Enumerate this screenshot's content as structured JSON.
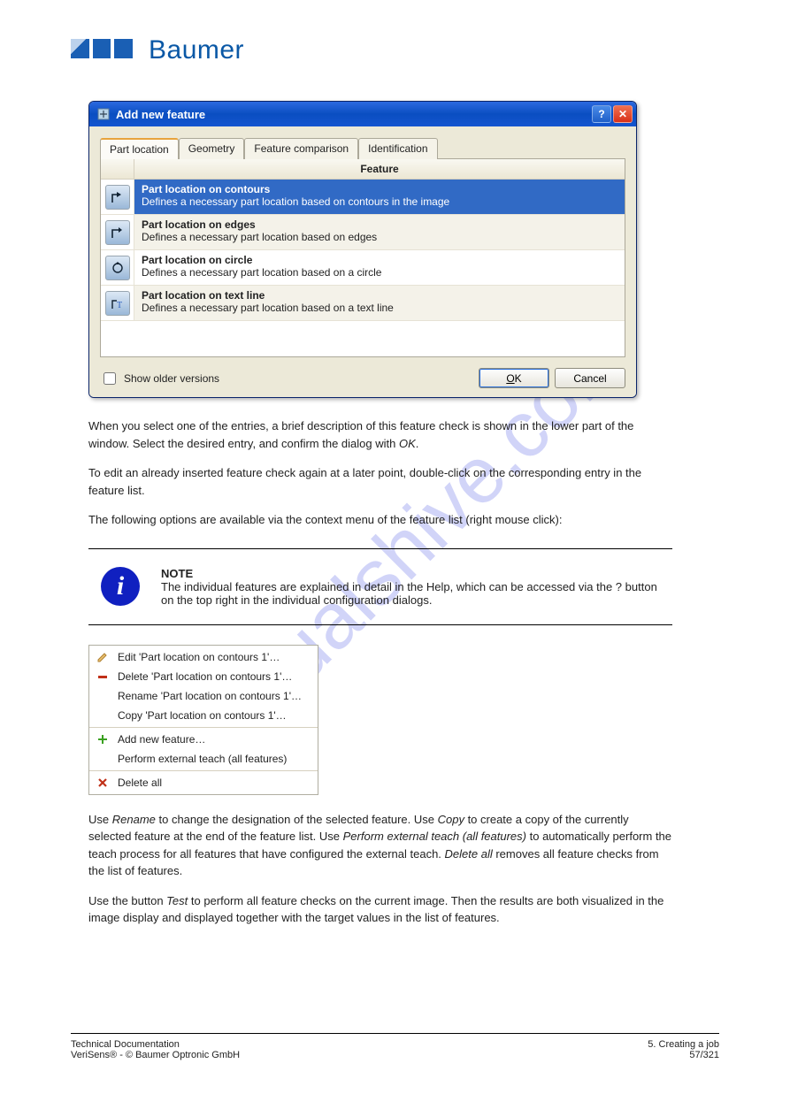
{
  "brand_name": "Baumer",
  "watermark": "manualshive.com",
  "dialog": {
    "title": "Add new feature",
    "tabs": [
      "Part location",
      "Geometry",
      "Feature comparison",
      "Identification"
    ],
    "feature_column_header": "Feature",
    "features": [
      {
        "title": "Part location on contours",
        "desc": "Defines a necessary part location based on contours in the image"
      },
      {
        "title": "Part location on edges",
        "desc": "Defines a necessary part location based on edges"
      },
      {
        "title": "Part location on circle",
        "desc": "Defines a necessary part location based on a circle"
      },
      {
        "title": "Part location on text line",
        "desc": "Defines a necessary part location based on a text line"
      }
    ],
    "show_older_label": "Show older versions",
    "ok_label": "OK",
    "cancel_label": "Cancel"
  },
  "body": {
    "p1_a": "When you select one of the entries, a brief description of this feature check is shown in the lower part of the window. Select the desired entry, and confirm the dialog with ",
    "p1_em": "OK",
    "p1_b": ".",
    "p2": "To edit an already inserted feature check again at a later point, double-click on the corresponding entry in the feature list.",
    "p3": "The following options are available via the context menu of the feature list (right mouse click):"
  },
  "note": {
    "strong": "NOTE",
    "rest": "The individual features are explained in detail in the Help, which can be accessed via the ? button on the top right in the individual configuration dialogs."
  },
  "context_menu": {
    "items": [
      "Edit 'Part location on contours 1'…",
      "Delete 'Part location on contours 1'…",
      "Rename 'Part location on contours 1'…",
      "Copy 'Part location on contours 1'…",
      "Add new feature…",
      "Perform external teach (all features)",
      "Delete all"
    ]
  },
  "after_menu": {
    "p1_a": "Use ",
    "p1_em1": "Rename",
    "p1_b": " to change the designation of the selected feature. Use ",
    "p1_em2": "Copy",
    "p1_c": " to create a copy of the currently selected feature at the end of the feature list. Use ",
    "p1_em3": "Perform external teach (all features)",
    "p1_d": " to automatically perform the teach process for all features that have configured the external teach. ",
    "p1_em4": "Delete all",
    "p1_e": " removes all feature checks from the list of features.",
    "p2_a": "Use the button ",
    "p2_em": "Test",
    "p2_b": " to perform all feature checks on the current image. Then the results are both visualized in the image display and displayed together with the target values in the list of features."
  },
  "footer": {
    "left_line1": "Technical Documentation",
    "left_line2": "VeriSens® - © Baumer Optronic GmbH",
    "right_line1": "5. Creating a job",
    "right_line2": "57/321"
  }
}
